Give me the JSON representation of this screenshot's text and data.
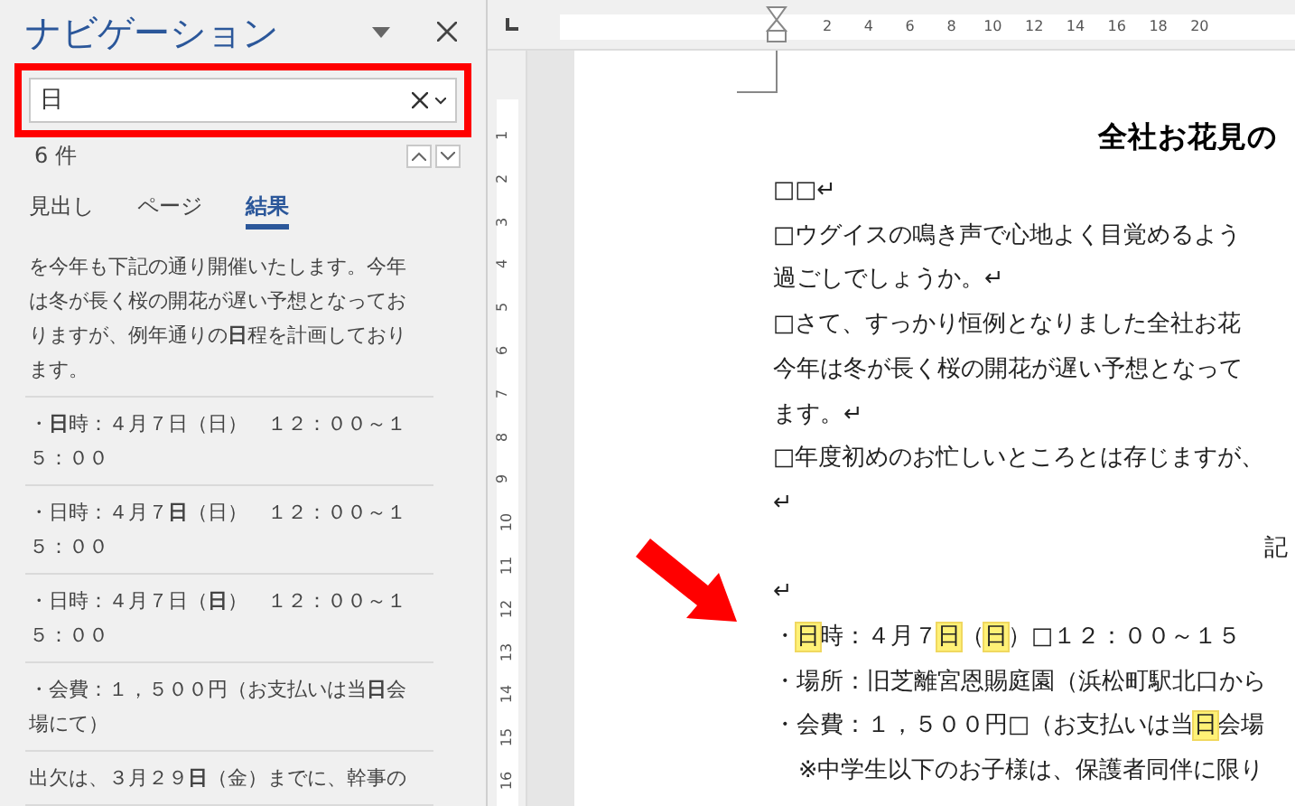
{
  "nav_pane": {
    "title": "ナビゲーション",
    "search": {
      "value": "日"
    },
    "result_count": "6 件",
    "tabs": [
      {
        "label": "見出し",
        "selected": false
      },
      {
        "label": "ページ",
        "selected": false
      },
      {
        "label": "結果",
        "selected": true
      }
    ],
    "results": [
      "を今年も下記の通り開催いたします。今年は冬が長く桜の開花が遅い予想となっておりますが、例年通りの**日**程を計画しております。",
      "・**日**時：４月７日（日）　１２：００～１５：００",
      "・日時：４月７**日**（日）　１２：００～１５：００",
      "・日時：４月７日（**日**）　１２：００～１５：００",
      "・会費：１，５００円（お支払いは当**日**会場にて）",
      "出欠は、３月２９**日**（金）までに、幹事の"
    ]
  },
  "ruler": {
    "horizontal": [
      "2",
      "4",
      "6",
      "8",
      "10",
      "12",
      "14",
      "16",
      "18",
      "20"
    ],
    "vertical": [
      "1",
      "2",
      "3",
      "4",
      "5",
      "6",
      "7",
      "8",
      "9",
      "10",
      "11",
      "12",
      "13",
      "14",
      "15",
      "16"
    ]
  },
  "document": {
    "title": "全社お花見の",
    "lines": [
      {
        "kind": "plain",
        "segments": [
          {
            "text": "□□↵",
            "highlight": false
          }
        ]
      },
      {
        "kind": "plain",
        "segments": [
          {
            "text": "□ウグイスの鳴き声で心地よく目覚めるよう",
            "highlight": false
          }
        ]
      },
      {
        "kind": "plain",
        "segments": [
          {
            "text": "過ごしでしょうか。↵",
            "highlight": false
          }
        ]
      },
      {
        "kind": "plain",
        "segments": [
          {
            "text": "□さて、すっかり恒例となりました全社お花",
            "highlight": false
          }
        ]
      },
      {
        "kind": "plain",
        "segments": [
          {
            "text": "今年は冬が長く桜の開花が遅い予想となって",
            "highlight": false
          }
        ]
      },
      {
        "kind": "plain",
        "segments": [
          {
            "text": "ます。↵",
            "highlight": false
          }
        ]
      },
      {
        "kind": "plain",
        "segments": [
          {
            "text": "□年度初めのお忙しいところとは存じますが、",
            "highlight": false
          }
        ]
      },
      {
        "kind": "plain",
        "segments": [
          {
            "text": "↵",
            "highlight": false
          }
        ]
      },
      {
        "kind": "right",
        "segments": [
          {
            "text": "記",
            "highlight": false
          }
        ]
      },
      {
        "kind": "plain",
        "segments": [
          {
            "text": "↵",
            "highlight": false
          }
        ]
      },
      {
        "kind": "plain",
        "segments": [
          {
            "text": "・",
            "highlight": false
          },
          {
            "text": "日",
            "highlight": true
          },
          {
            "text": "時：４月７",
            "highlight": false
          },
          {
            "text": "日",
            "highlight": true
          },
          {
            "text": "（",
            "highlight": false
          },
          {
            "text": "日",
            "highlight": true
          },
          {
            "text": "）□１２：００～１５",
            "highlight": false
          }
        ]
      },
      {
        "kind": "plain",
        "segments": [
          {
            "text": "・場所：旧芝離宮恩賜庭園（浜松町駅北口から",
            "highlight": false
          }
        ]
      },
      {
        "kind": "plain",
        "segments": [
          {
            "text": "・会費：１，５００円□（お支払いは当",
            "highlight": false
          },
          {
            "text": "日",
            "highlight": true
          },
          {
            "text": "会場",
            "highlight": false
          }
        ]
      },
      {
        "kind": "indented",
        "segments": [
          {
            "text": "※中学生以下のお子様は、保護者同伴に限り",
            "highlight": false
          }
        ]
      }
    ]
  }
}
